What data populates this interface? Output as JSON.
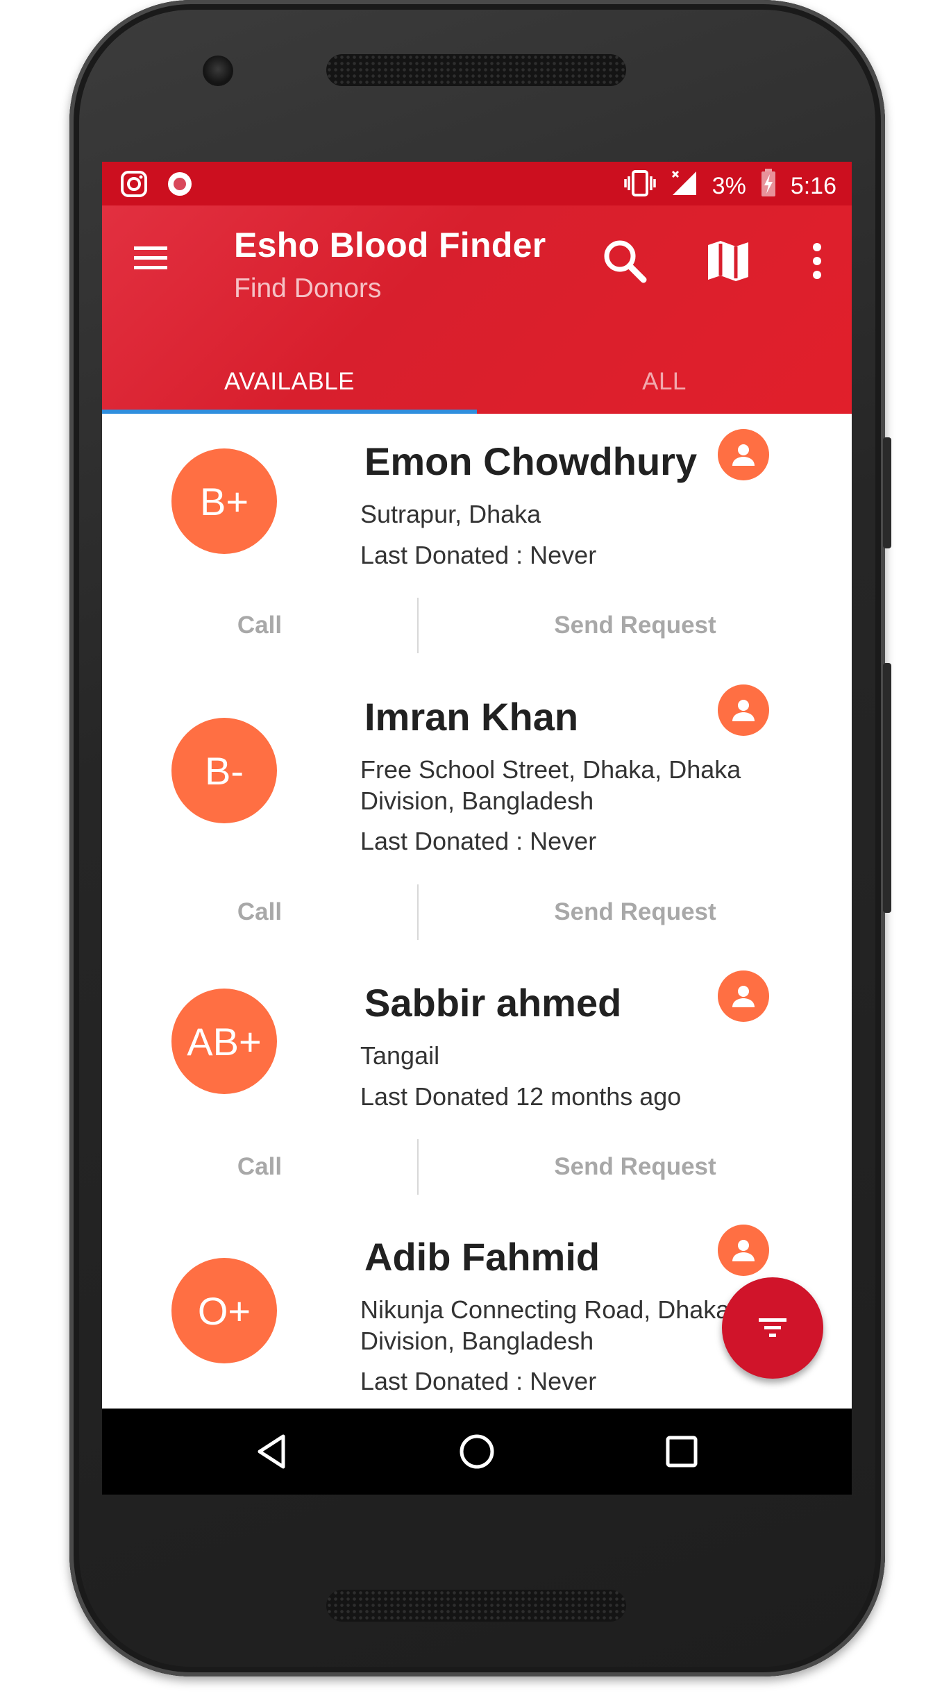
{
  "status_bar": {
    "battery": "3%",
    "time": "5:16"
  },
  "app_bar": {
    "title": "Esho Blood Finder",
    "subtitle": "Find Donors"
  },
  "tabs": [
    {
      "label": "AVAILABLE",
      "active": true
    },
    {
      "label": "ALL",
      "active": false
    }
  ],
  "donors": [
    {
      "blood_group": "B+",
      "name": "Emon Chowdhury",
      "location": "Sutrapur, Dhaka",
      "last_donated": "Last Donated : Never",
      "call_label": "Call",
      "request_label": "Send Request"
    },
    {
      "blood_group": "B-",
      "name": "Imran Khan",
      "location": "Free School Street, Dhaka, Dhaka Division, Bangladesh",
      "last_donated": "Last Donated : Never",
      "call_label": "Call",
      "request_label": "Send Request"
    },
    {
      "blood_group": "AB+",
      "name": "Sabbir ahmed",
      "location": "Tangail",
      "last_donated": "Last Donated 12 months ago",
      "call_label": "Call",
      "request_label": "Send Request"
    },
    {
      "blood_group": "O+",
      "name": "Adib Fahmid",
      "location": "Nikunja Connecting Road, Dhaka Division, Bangladesh",
      "last_donated": "Last Donated : Never"
    }
  ],
  "colors": {
    "primary": "#d81f2d",
    "status_bar": "#cc0f1f",
    "accent_badge": "#ff6f43",
    "fab": "#d0142a",
    "tab_indicator": "#2f8fde"
  },
  "icons": {
    "menu": "hamburger-icon",
    "search": "search-icon",
    "map": "map-icon",
    "overflow": "more-vert-icon",
    "profile": "person-icon",
    "fab": "filter-icon",
    "nav_back": "triangle-back-icon",
    "nav_home": "circle-home-icon",
    "nav_recents": "square-recents-icon"
  }
}
